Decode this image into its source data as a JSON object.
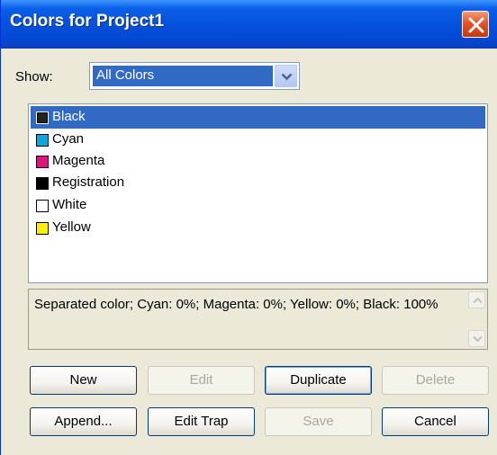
{
  "window": {
    "title": "Colors for Project1",
    "close_icon": "close-icon"
  },
  "show": {
    "label": "Show:",
    "selected": "All Colors",
    "dropdown_icon": "chevron-down-icon"
  },
  "colors": [
    {
      "name": "Black",
      "swatch": "#222222",
      "selected": true
    },
    {
      "name": "Cyan",
      "swatch": "#0fa6e0",
      "selected": false
    },
    {
      "name": "Magenta",
      "swatch": "#e0137f",
      "selected": false
    },
    {
      "name": "Registration",
      "swatch": "#000000",
      "selected": false
    },
    {
      "name": "White",
      "swatch": "#ffffff",
      "selected": false
    },
    {
      "name": "Yellow",
      "swatch": "#ffee00",
      "selected": false
    }
  ],
  "description": "Separated color; Cyan: 0%; Magenta: 0%; Yellow: 0%; Black: 100%",
  "buttons": {
    "new": "New",
    "edit": "Edit",
    "duplicate": "Duplicate",
    "delete": "Delete",
    "append": "Append...",
    "edit_trap": "Edit Trap",
    "save": "Save",
    "cancel": "Cancel"
  },
  "theme": {
    "selection": "#316ac5",
    "titlebar": "#0552dc",
    "dialog_bg": "#ece9d8"
  }
}
